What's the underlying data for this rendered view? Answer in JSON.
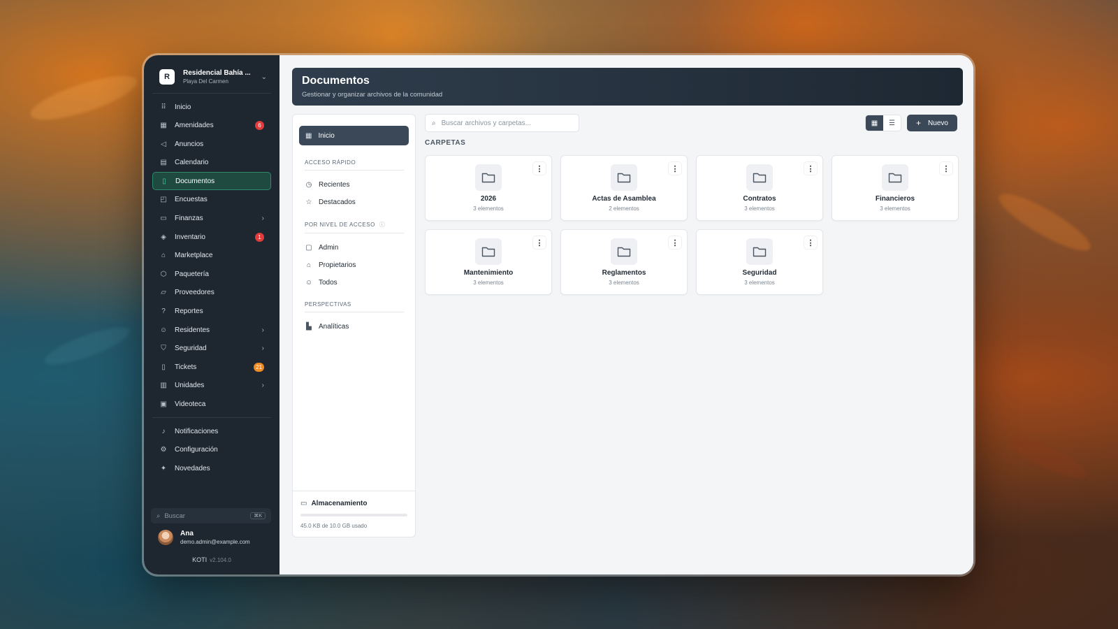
{
  "sidebar": {
    "org": {
      "initial": "R",
      "name": "Residencial Bahía ...",
      "location": "Playa Del Carmen"
    },
    "items": [
      {
        "label": "Inicio",
        "icon": "grip-icon"
      },
      {
        "label": "Amenidades",
        "icon": "building-icon",
        "badge": "6"
      },
      {
        "label": "Anuncios",
        "icon": "megaphone-icon"
      },
      {
        "label": "Calendario",
        "icon": "calendar-icon"
      },
      {
        "label": "Documentos",
        "icon": "document-icon",
        "active": true
      },
      {
        "label": "Encuestas",
        "icon": "poll-icon"
      },
      {
        "label": "Finanzas",
        "icon": "wallet-icon",
        "chevron": true
      },
      {
        "label": "Inventario",
        "icon": "boxes-icon",
        "badge": "1"
      },
      {
        "label": "Marketplace",
        "icon": "store-icon"
      },
      {
        "label": "Paquetería",
        "icon": "package-icon"
      },
      {
        "label": "Proveedores",
        "icon": "truck-icon"
      },
      {
        "label": "Reportes",
        "icon": "help-circle-icon"
      },
      {
        "label": "Residentes",
        "icon": "users-icon",
        "chevron": true
      },
      {
        "label": "Seguridad",
        "icon": "shield-icon",
        "chevron": true
      },
      {
        "label": "Tickets",
        "icon": "ticket-icon",
        "badge": "21"
      },
      {
        "label": "Unidades",
        "icon": "unit-icon",
        "chevron": true
      },
      {
        "label": "Videoteca",
        "icon": "video-icon"
      }
    ],
    "bottom_items": [
      {
        "label": "Notificaciones",
        "icon": "bell-icon"
      },
      {
        "label": "Configuración",
        "icon": "gear-icon"
      },
      {
        "label": "Novedades",
        "icon": "sparkles-icon"
      }
    ],
    "search": {
      "placeholder": "Buscar",
      "shortcut": "⌘K"
    },
    "user": {
      "name": "Ana",
      "email": "demo.admin@example.com"
    },
    "app": {
      "name": "KOTI",
      "version": "v2.104.0"
    }
  },
  "header": {
    "title": "Documentos",
    "subtitle": "Gestionar y organizar archivos de la comunidad"
  },
  "panel": {
    "home_label": "Inicio",
    "quick_access_title": "ACCESO RÁPIDO",
    "quick_access": [
      {
        "label": "Recientes",
        "icon": "clock-icon"
      },
      {
        "label": "Destacados",
        "icon": "star-icon"
      }
    ],
    "access_level_title": "POR NIVEL DE ACCESO",
    "access_levels": [
      {
        "label": "Admin",
        "icon": "lock-icon"
      },
      {
        "label": "Propietarios",
        "icon": "home-icon"
      },
      {
        "label": "Todos",
        "icon": "users-icon"
      }
    ],
    "perspectives_title": "PERSPECTIVAS",
    "perspectives": [
      {
        "label": "Analíticas",
        "icon": "bar-chart-icon"
      }
    ],
    "storage": {
      "title": "Almacenamiento",
      "usage": "45.0 KB de 10.0 GB usado",
      "fraction": 4.5e-06
    }
  },
  "toolbar": {
    "search_placeholder": "Buscar archivos y carpetas...",
    "new_label": "Nuevo",
    "view": "grid"
  },
  "folders_title": "CARPETAS",
  "folders": [
    {
      "name": "2026",
      "count": "3 elementos"
    },
    {
      "name": "Actas de Asamblea",
      "count": "2 elementos"
    },
    {
      "name": "Contratos",
      "count": "3 elementos"
    },
    {
      "name": "Financieros",
      "count": "3 elementos"
    },
    {
      "name": "Mantenimiento",
      "count": "3 elementos"
    },
    {
      "name": "Reglamentos",
      "count": "3 elementos"
    },
    {
      "name": "Seguridad",
      "count": "3 elementos"
    }
  ],
  "colors": {
    "sidebar_bg": "#1e2730",
    "active_accent": "#2f8a6c",
    "badge_red": "#e23b3b",
    "badge_orange": "#f08a24",
    "primary_button": "#3b4858"
  }
}
